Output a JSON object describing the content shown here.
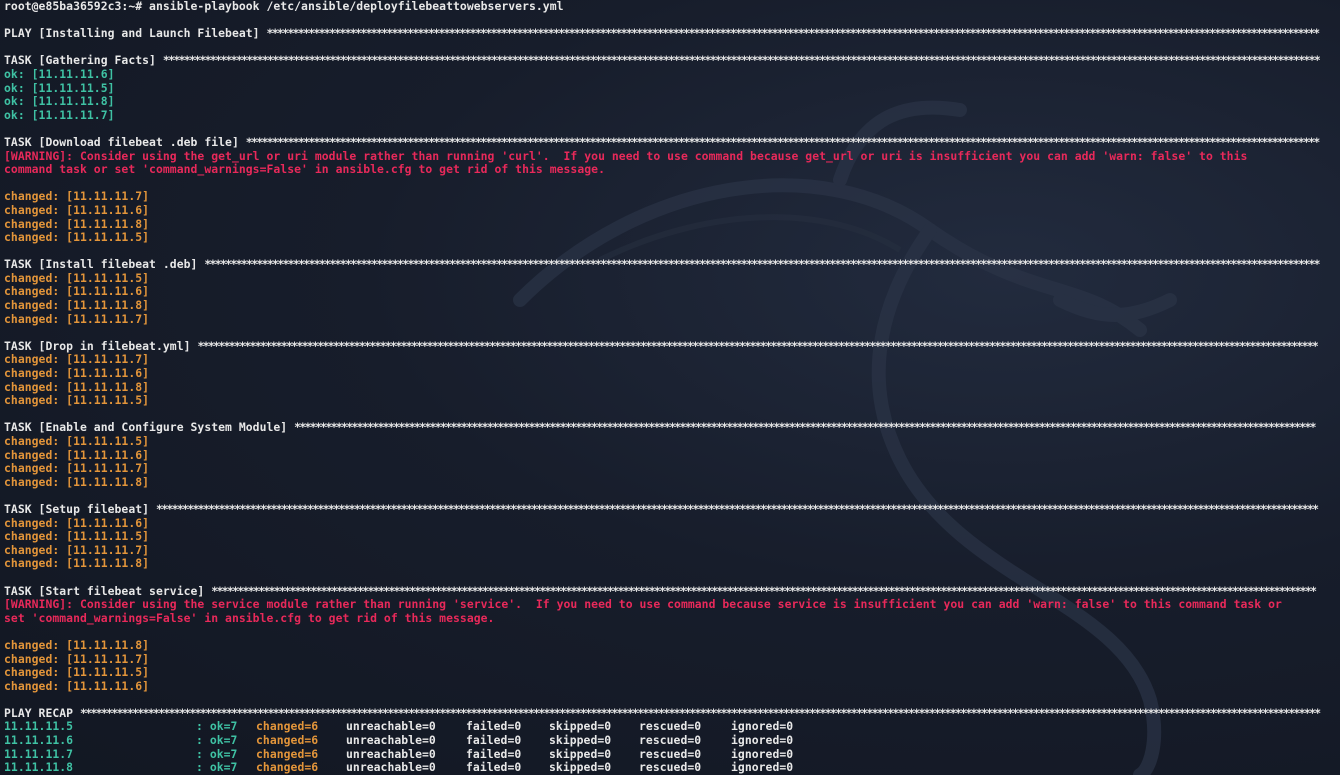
{
  "colors": {
    "background": "#141a27",
    "text": "#e8e8e8",
    "ok": "#3fc2a4",
    "changed": "#e3953a",
    "warning": "#e8295a"
  },
  "prompt": "root@e85ba36592c3:~# ansible-playbook /etc/ansible/deployfilebeattowebservers.yml",
  "play": "PLAY [Installing and Launch Filebeat]",
  "tasks": [
    {
      "header": "TASK [Gathering Facts]",
      "warning": [],
      "results": [
        {
          "status": "ok",
          "text": "ok: [11.11.11.6]"
        },
        {
          "status": "ok",
          "text": "ok: [11.11.11.5]"
        },
        {
          "status": "ok",
          "text": "ok: [11.11.11.8]"
        },
        {
          "status": "ok",
          "text": "ok: [11.11.11.7]"
        }
      ]
    },
    {
      "header": "TASK [Download filebeat .deb file]",
      "warning": [
        "[WARNING]: Consider using the get_url or uri module rather than running 'curl'.  If you need to use command because get_url or uri is insufficient you can add 'warn: false' to this",
        "command task or set 'command_warnings=False' in ansible.cfg to get rid of this message."
      ],
      "results": [
        {
          "status": "changed",
          "text": "changed: [11.11.11.7]"
        },
        {
          "status": "changed",
          "text": "changed: [11.11.11.6]"
        },
        {
          "status": "changed",
          "text": "changed: [11.11.11.8]"
        },
        {
          "status": "changed",
          "text": "changed: [11.11.11.5]"
        }
      ]
    },
    {
      "header": "TASK [Install filebeat .deb]",
      "warning": [],
      "results": [
        {
          "status": "changed",
          "text": "changed: [11.11.11.5]"
        },
        {
          "status": "changed",
          "text": "changed: [11.11.11.6]"
        },
        {
          "status": "changed",
          "text": "changed: [11.11.11.8]"
        },
        {
          "status": "changed",
          "text": "changed: [11.11.11.7]"
        }
      ]
    },
    {
      "header": "TASK [Drop in filebeat.yml]",
      "warning": [],
      "results": [
        {
          "status": "changed",
          "text": "changed: [11.11.11.7]"
        },
        {
          "status": "changed",
          "text": "changed: [11.11.11.6]"
        },
        {
          "status": "changed",
          "text": "changed: [11.11.11.8]"
        },
        {
          "status": "changed",
          "text": "changed: [11.11.11.5]"
        }
      ]
    },
    {
      "header": "TASK [Enable and Configure System Module]",
      "warning": [],
      "results": [
        {
          "status": "changed",
          "text": "changed: [11.11.11.5]"
        },
        {
          "status": "changed",
          "text": "changed: [11.11.11.6]"
        },
        {
          "status": "changed",
          "text": "changed: [11.11.11.7]"
        },
        {
          "status": "changed",
          "text": "changed: [11.11.11.8]"
        }
      ]
    },
    {
      "header": "TASK [Setup filebeat]",
      "warning": [],
      "results": [
        {
          "status": "changed",
          "text": "changed: [11.11.11.6]"
        },
        {
          "status": "changed",
          "text": "changed: [11.11.11.5]"
        },
        {
          "status": "changed",
          "text": "changed: [11.11.11.7]"
        },
        {
          "status": "changed",
          "text": "changed: [11.11.11.8]"
        }
      ]
    },
    {
      "header": "TASK [Start filebeat service]",
      "warning": [
        "[WARNING]: Consider using the service module rather than running 'service'.  If you need to use command because service is insufficient you can add 'warn: false' to this command task or",
        "set 'command_warnings=False' in ansible.cfg to get rid of this message."
      ],
      "results": [
        {
          "status": "changed",
          "text": "changed: [11.11.11.8]"
        },
        {
          "status": "changed",
          "text": "changed: [11.11.11.7]"
        },
        {
          "status": "changed",
          "text": "changed: [11.11.11.5]"
        },
        {
          "status": "changed",
          "text": "changed: [11.11.11.6]"
        }
      ]
    }
  ],
  "recap": {
    "header": "PLAY RECAP",
    "rows": [
      {
        "host": "11.11.11.5",
        "ok": ": ok=7",
        "changed": "changed=6",
        "unreachable": "unreachable=0",
        "failed": "failed=0",
        "skipped": "skipped=0",
        "rescued": "rescued=0",
        "ignored": "ignored=0"
      },
      {
        "host": "11.11.11.6",
        "ok": ": ok=7",
        "changed": "changed=6",
        "unreachable": "unreachable=0",
        "failed": "failed=0",
        "skipped": "skipped=0",
        "rescued": "rescued=0",
        "ignored": "ignored=0"
      },
      {
        "host": "11.11.11.7",
        "ok": ": ok=7",
        "changed": "changed=6",
        "unreachable": "unreachable=0",
        "failed": "failed=0",
        "skipped": "skipped=0",
        "rescued": "rescued=0",
        "ignored": "ignored=0"
      },
      {
        "host": "11.11.11.8",
        "ok": ": ok=7",
        "changed": "changed=6",
        "unreachable": "unreachable=0",
        "failed": "failed=0",
        "skipped": "skipped=0",
        "rescued": "rescued=0",
        "ignored": "ignored=0"
      }
    ]
  }
}
